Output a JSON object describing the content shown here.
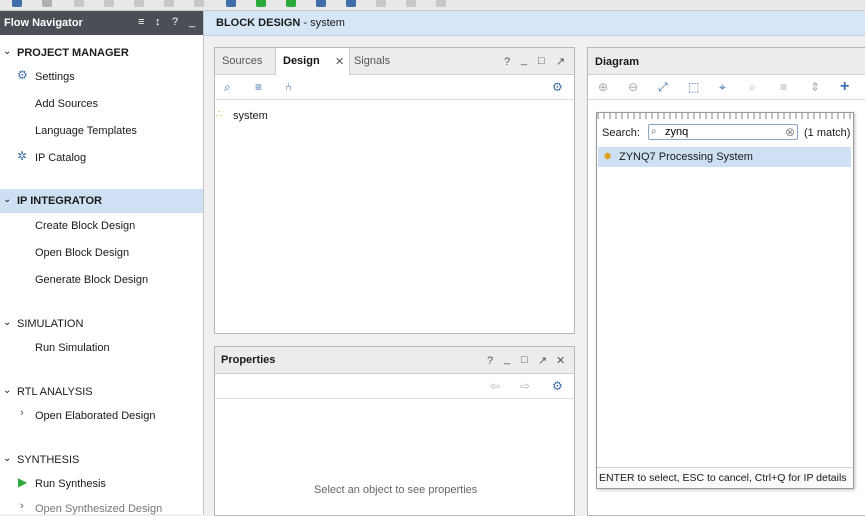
{
  "flow_navigator": {
    "title": "Flow Navigator",
    "sections": [
      {
        "label": "PROJECT MANAGER",
        "items": [
          "Settings",
          "Add Sources",
          "Language Templates",
          "IP Catalog"
        ]
      },
      {
        "label": "IP INTEGRATOR",
        "items": [
          "Create Block Design",
          "Open Block Design",
          "Generate Block Design"
        ]
      },
      {
        "label": "SIMULATION",
        "items": [
          "Run Simulation"
        ]
      },
      {
        "label": "RTL ANALYSIS",
        "items": [
          "Open Elaborated Design"
        ]
      },
      {
        "label": "SYNTHESIS",
        "items": [
          "Run Synthesis",
          "Open Synthesized Design"
        ]
      }
    ]
  },
  "block_design": {
    "title_prefix": "BLOCK DESIGN",
    "title_name": " - system"
  },
  "sources_panel": {
    "tabs": [
      "Sources",
      "Design",
      "Signals"
    ],
    "tree_items": [
      "system"
    ]
  },
  "properties_panel": {
    "title": "Properties",
    "empty_message": "Select an object to see properties"
  },
  "diagram_panel": {
    "title": "Diagram",
    "search_label": "Search:",
    "search_value": "zynq",
    "match_count": "(1 match)",
    "results": [
      "ZYNQ7 Processing System"
    ],
    "footer_hint": "ENTER to select, ESC to cancel, Ctrl+Q for IP details"
  },
  "colors": {
    "accent": "#3f6fa8",
    "selection": "#cfe0f4",
    "header": "#d7e6f7",
    "run_green": "#2eaa3c"
  }
}
